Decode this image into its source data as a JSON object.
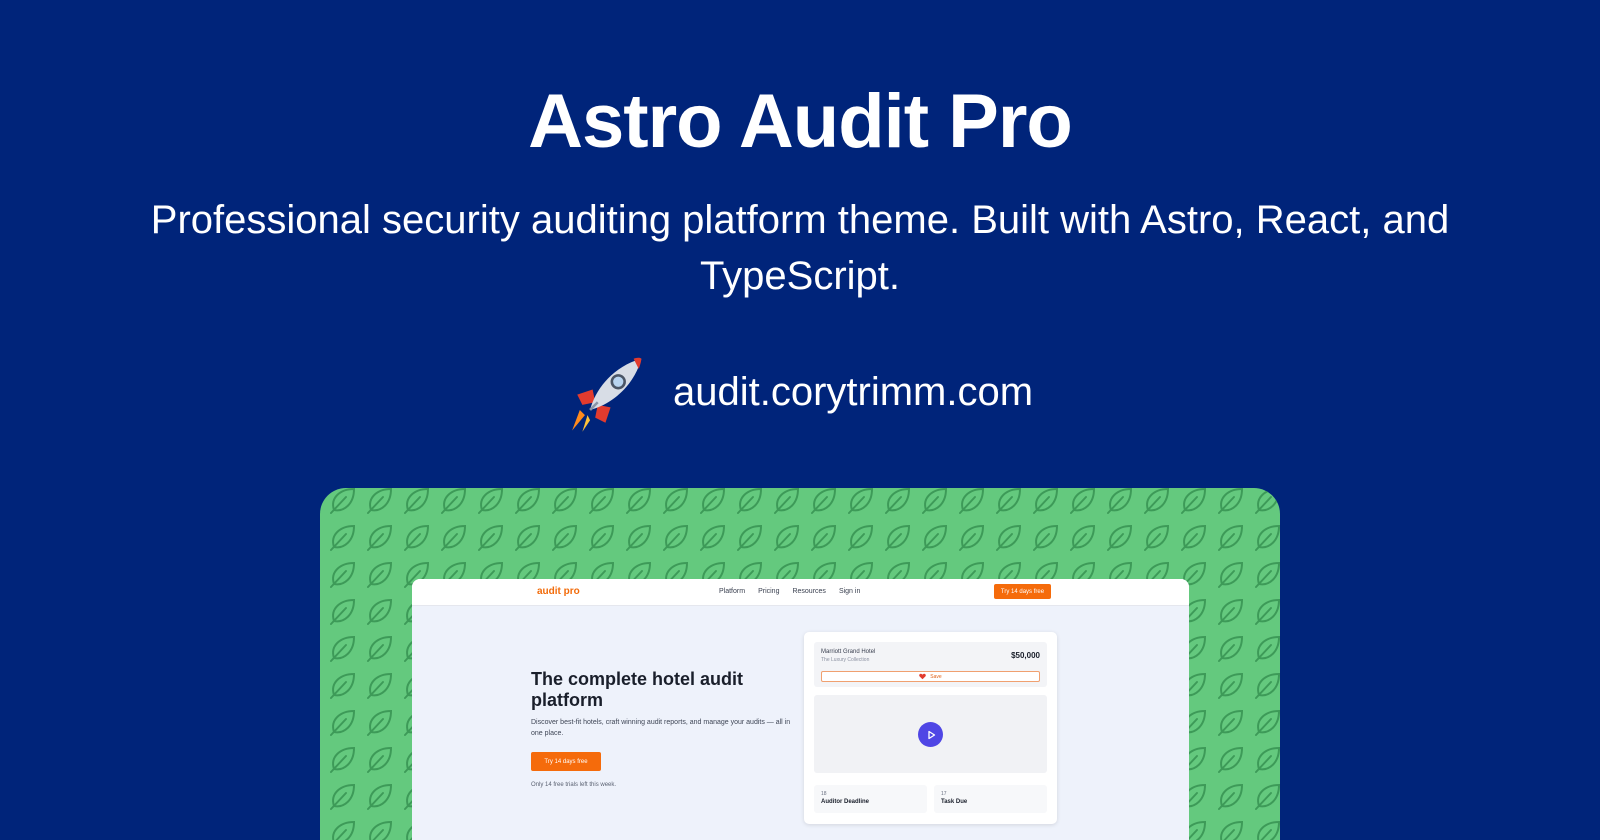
{
  "hero": {
    "title": "Astro Audit Pro",
    "subtitle": "Professional security auditing platform theme. Built with Astro, React, and TypeScript.",
    "url": "audit.corytrimm.com",
    "url_icon": "rocket-icon"
  },
  "colors": {
    "background": "#00247a",
    "preview_background": "#64c97e",
    "accent": "#f56b0b",
    "play": "#4f46e5"
  },
  "preview": {
    "nav": {
      "logo": "audit pro",
      "links": [
        "Platform",
        "Pricing",
        "Resources",
        "Sign in"
      ],
      "cta": "Try 14 days free"
    },
    "headline": "The complete hotel audit platform",
    "description": "Discover best-fit hotels, craft winning audit reports, and manage your audits — all in one place.",
    "cta": "Try 14 days free",
    "note": "Only 14 free trials left this week.",
    "card": {
      "hotel_name": "Marriott Grand Hotel",
      "hotel_collection": "The Luxury Collection",
      "price": "$50,000",
      "save_label": "Save",
      "stats": [
        {
          "number": "18",
          "label": "Auditor Deadline"
        },
        {
          "number": "17",
          "label": "Task Due"
        }
      ]
    }
  }
}
